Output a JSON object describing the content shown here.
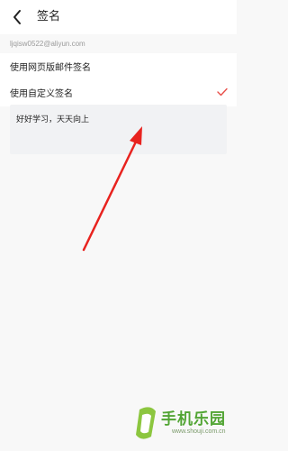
{
  "header": {
    "title": "签名",
    "back_icon": "chevron-left-icon"
  },
  "account": {
    "email": "ljqisw0522@aliyun.com"
  },
  "options": [
    {
      "label": "使用网页版邮件签名",
      "selected": false
    },
    {
      "label": "使用自定义签名",
      "selected": true
    }
  ],
  "signature": {
    "text": "好好学习，天天向上"
  },
  "colors": {
    "accent": "#e8504a",
    "annotation": "#e8231f",
    "watermark": "#52a534"
  },
  "watermark": {
    "name": "手机乐园",
    "url": "www.shouji.com.cn"
  }
}
